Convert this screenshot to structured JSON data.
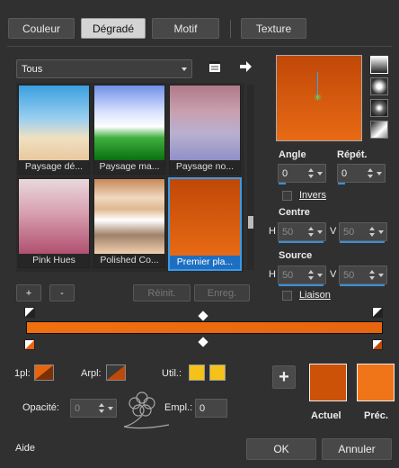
{
  "tabs": [
    {
      "label": "Couleur"
    },
    {
      "label": "Dégradé"
    },
    {
      "label": "Motif"
    },
    {
      "label": "Texture"
    }
  ],
  "preset_dropdown": {
    "value": "Tous"
  },
  "presets": [
    {
      "label": "Paysage dé..."
    },
    {
      "label": "Paysage ma..."
    },
    {
      "label": "Paysage no..."
    },
    {
      "label": "Pink Hues"
    },
    {
      "label": "Polished Co..."
    },
    {
      "label": "Premier pla..."
    }
  ],
  "preset_buttons": {
    "add": "+",
    "remove": "-",
    "reset": "Réinit.",
    "save": "Enreg."
  },
  "angle": {
    "label": "Angle",
    "value": "0"
  },
  "repeat": {
    "label": "Répét.",
    "value": "0"
  },
  "invert": {
    "label": "Invers"
  },
  "centre": {
    "label": "Centre",
    "h_label": "H",
    "h_value": "50",
    "v_label": "V",
    "v_value": "50"
  },
  "source": {
    "label": "Source",
    "h_label": "H",
    "h_value": "50",
    "v_label": "V",
    "v_value": "50"
  },
  "link": {
    "label": "Liaison"
  },
  "gradient_colors": {
    "start": "#f07010",
    "end": "#c04808",
    "accent": "#2aa7ff"
  },
  "stop": {
    "fg_label": "1pl:",
    "bg_label": "Arpl:",
    "user_label": "Util.:",
    "opacity_label": "Opacité:",
    "opacity_value": "0",
    "location_label": "Empl.:",
    "location_value": "0",
    "user_color": "#f5c21a"
  },
  "swatches": {
    "current_label": "Actuel",
    "previous_label": "Préc.",
    "current_color": "#cc5208",
    "previous_color": "#f07418"
  },
  "footer": {
    "help": "Aide",
    "ok": "OK",
    "cancel": "Annuler"
  }
}
